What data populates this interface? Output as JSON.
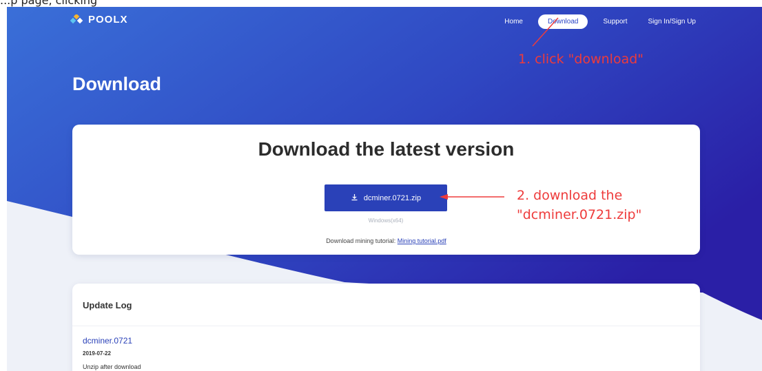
{
  "caption_fragment": "...p page, clicking",
  "header": {
    "logo_text": "POOLX",
    "nav": [
      {
        "label": "Home"
      },
      {
        "label": "Download"
      },
      {
        "label": "Support"
      },
      {
        "label": "Sign In/Sign Up"
      }
    ]
  },
  "page_title": "Download",
  "download_card": {
    "title": "Download the latest version",
    "button_label": "dcminer.0721.zip",
    "button_icon": "download-icon",
    "platform": "Windows(x64)",
    "tutorial_prefix": "Download mining tutorial:",
    "tutorial_link": "Mining tutorial.pdf"
  },
  "update_log": {
    "title": "Update Log",
    "entries": [
      {
        "version": "dcminer.0721",
        "date": "2019-07-22",
        "note": "Unzip after download"
      }
    ]
  },
  "annotations": {
    "step1": "1. click \"download\"",
    "step2_line1": "2. download the",
    "step2_line2": "\"dcminer.0721.zip\""
  },
  "colors": {
    "hero_start": "#3a6fd8",
    "hero_end": "#2a1fa6",
    "button": "#2a41b8",
    "annotation": "#ee3b3b"
  }
}
